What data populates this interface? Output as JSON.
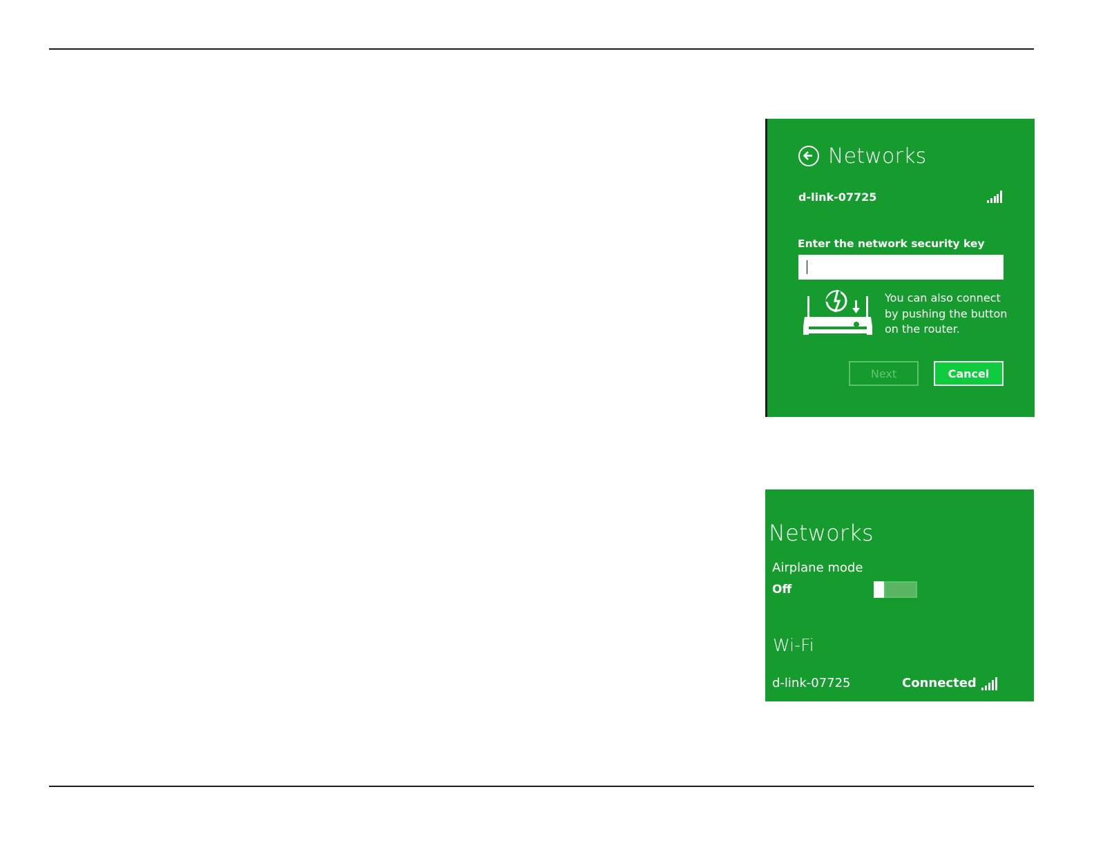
{
  "connect_panel": {
    "title": "Networks",
    "network_name": "d-link-07725",
    "prompt_label": "Enter the network security key",
    "key_value": "",
    "wps_hint_line1": "You can also connect",
    "wps_hint_line2": "by pushing the button",
    "wps_hint_line3": "on the router.",
    "next_label": "Next",
    "cancel_label": "Cancel"
  },
  "status_panel": {
    "title": "Networks",
    "airplane_label": "Airplane mode",
    "airplane_state": "Off",
    "wifi_heading": "Wi-Fi",
    "network_name": "d-link-07725",
    "connection_status": "Connected"
  },
  "colors": {
    "panel_green": "#169b2e",
    "cancel_green": "#0fcc3f",
    "next_disabled": "#62c76f"
  }
}
